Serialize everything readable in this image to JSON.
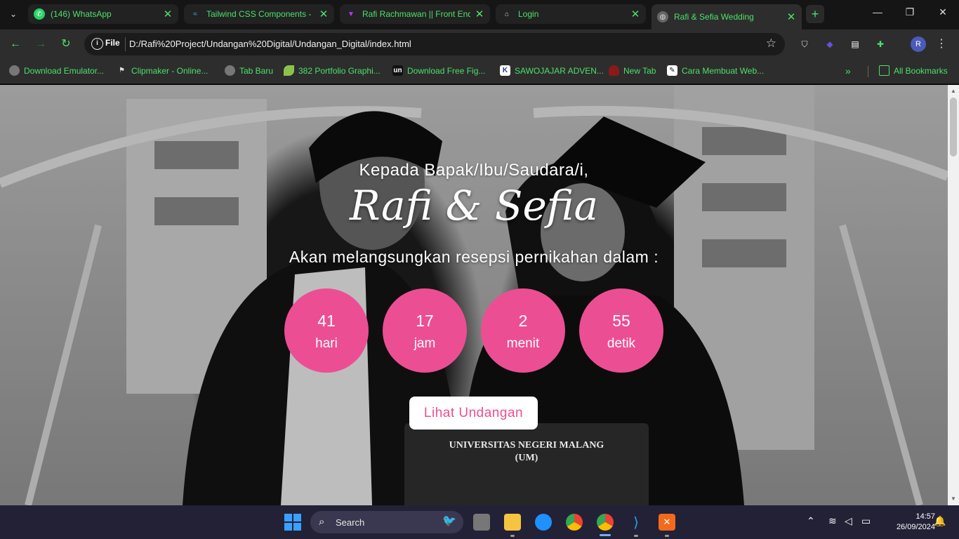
{
  "browser": {
    "tabs": [
      {
        "title": "(146) WhatsApp",
        "icon": "whatsapp-icon",
        "color": "#25d366"
      },
      {
        "title": "Tailwind CSS Components -",
        "icon": "tailwind-icon",
        "color": "#38bdf8"
      },
      {
        "title": "Rafi Rachmawan || Front End",
        "icon": "vite-icon",
        "color": "#bd34fe"
      },
      {
        "title": "Login",
        "icon": "home-icon",
        "color": "#cccccc"
      },
      {
        "title": "Rafi & Sefia Wedding",
        "icon": "globe-icon",
        "color": "#cccccc"
      }
    ],
    "address": {
      "scheme_label": "File",
      "url": "D:/Rafi%20Project/Undangan%20Digital/Undangan_Digital/index.html"
    },
    "bookmarks": [
      {
        "label": "Download Emulator...",
        "icon": "globe-icon"
      },
      {
        "label": "Clipmaker - Online...",
        "icon": "clipmaker-icon"
      },
      {
        "label": "Tab Baru",
        "icon": "globe-icon"
      },
      {
        "label": "382 Portfolio Graphi...",
        "icon": "leaf-icon"
      },
      {
        "label": "Download Free Fig...",
        "icon": "un-icon"
      },
      {
        "label": "SAWOJAJAR ADVEN...",
        "icon": "k-icon"
      },
      {
        "label": "New Tab",
        "icon": "mushroom-icon"
      },
      {
        "label": "Cara Membuat Web...",
        "icon": "pen-icon"
      }
    ],
    "all_bookmarks_label": "All Bookmarks",
    "profile_initial": "R"
  },
  "page": {
    "greeting": "Kepada Bapak/Ibu/Saudara/i,",
    "couple_names": "Rafi & Sefia",
    "subtitle": "Akan melangsungkan resepsi pernikahan dalam :",
    "countdown": [
      {
        "value": "41",
        "unit": "hari"
      },
      {
        "value": "17",
        "unit": "jam"
      },
      {
        "value": "2",
        "unit": "menit"
      },
      {
        "value": "55",
        "unit": "detik"
      }
    ],
    "cta_label": "Lihat Undangan",
    "photo_text": {
      "line1": "UNIVERSITAS NEGERI MALANG",
      "line2": "(UM)"
    },
    "accent_color": "#ec4e93"
  },
  "taskbar": {
    "search_label": "Search",
    "time": "14:57",
    "date": "26/09/2024"
  }
}
